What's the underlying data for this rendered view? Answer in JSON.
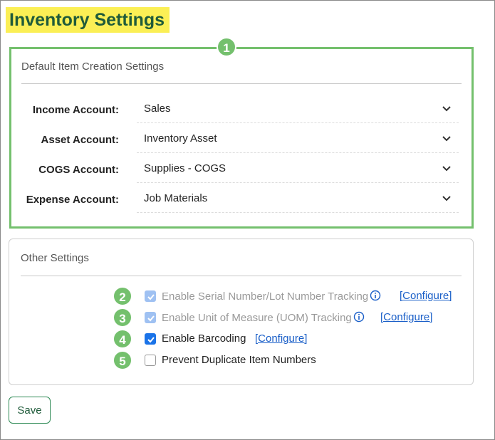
{
  "page": {
    "title": "Inventory Settings"
  },
  "default_item_creation": {
    "title": "Default Item Creation Settings",
    "badge": "1",
    "fields": [
      {
        "label": "Income Account:",
        "value": "Sales"
      },
      {
        "label": "Asset Account:",
        "value": "Inventory Asset"
      },
      {
        "label": "COGS Account:",
        "value": "Supplies - COGS"
      },
      {
        "label": "Expense Account:",
        "value": "Job Materials"
      }
    ]
  },
  "other_settings": {
    "title": "Other Settings",
    "options": [
      {
        "badge": "2",
        "label": "Enable Serial Number/Lot Number Tracking",
        "checked": true,
        "disabled": true,
        "info": true,
        "configure": "[Configure]"
      },
      {
        "badge": "3",
        "label": "Enable Unit of Measure (UOM) Tracking",
        "checked": true,
        "disabled": true,
        "info": true,
        "configure": "[Configure]"
      },
      {
        "badge": "4",
        "label": "Enable Barcoding",
        "checked": true,
        "disabled": false,
        "info": false,
        "configure": "[Configure]"
      },
      {
        "badge": "5",
        "label": "Prevent Duplicate Item Numbers",
        "checked": false,
        "disabled": false,
        "info": false,
        "configure": ""
      }
    ]
  },
  "actions": {
    "save_label": "Save"
  },
  "colors": {
    "title_highlight": "#fbef55",
    "title_text": "#1f5b3a",
    "accent_green": "#74c06d",
    "link_blue": "#1a5fc8",
    "checkbox_blue": "#1a73e8"
  }
}
